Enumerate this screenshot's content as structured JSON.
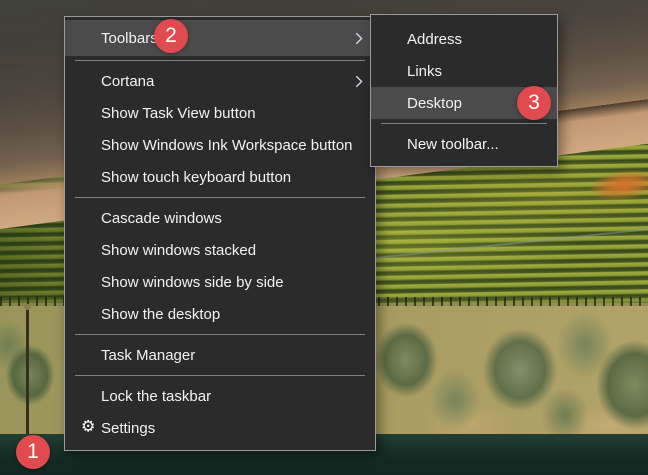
{
  "taskbar_menu": {
    "items": [
      {
        "label": "Toolbars",
        "has_submenu": true,
        "highlighted": true
      },
      {
        "label": "Cortana",
        "has_submenu": true
      },
      {
        "label": "Show Task View button"
      },
      {
        "label": "Show Windows Ink Workspace button"
      },
      {
        "label": "Show touch keyboard button"
      },
      {
        "label": "Cascade windows"
      },
      {
        "label": "Show windows stacked"
      },
      {
        "label": "Show windows side by side"
      },
      {
        "label": "Show the desktop"
      },
      {
        "label": "Task Manager"
      },
      {
        "label": "Lock the taskbar"
      },
      {
        "label": "Settings",
        "icon": "gear-icon"
      }
    ]
  },
  "toolbars_submenu": {
    "items": [
      {
        "label": "Address"
      },
      {
        "label": "Links"
      },
      {
        "label": "Desktop",
        "highlighted": true
      },
      {
        "label": "New toolbar..."
      }
    ]
  },
  "annotations": {
    "badges": [
      {
        "label": "1"
      },
      {
        "label": "2"
      },
      {
        "label": "3"
      }
    ]
  },
  "icons": {
    "gear_glyph": "⚙"
  },
  "colors": {
    "menu_background": "#2b2b2b",
    "menu_highlight": "#4b4b4b",
    "menu_border": "#9b9b9b",
    "menu_text": "#f2f2f2",
    "separator": "#7f7f7f",
    "badge_red": "#e14b4f",
    "taskbar": "#152e26"
  }
}
